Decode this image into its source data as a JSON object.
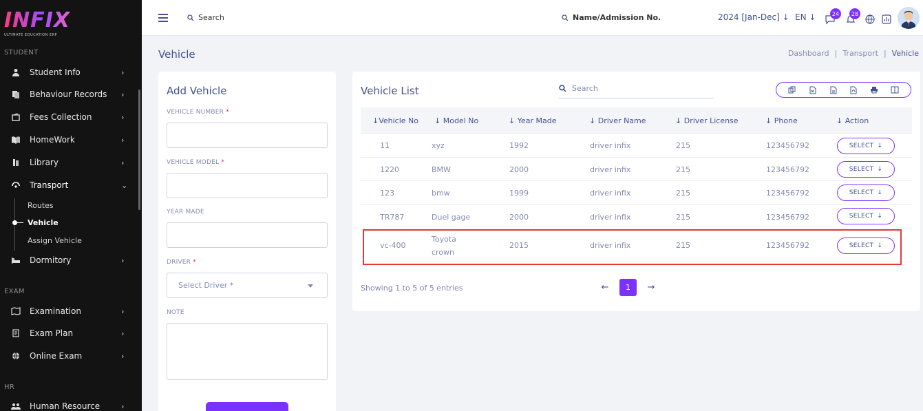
{
  "brand": {
    "logo_text": "INFIX",
    "tagline": "ULTIMATE EDUCATION ERP"
  },
  "sidebar": {
    "sections": {
      "student": "STUDENT",
      "exam": "EXAM",
      "hr": "HR"
    },
    "items": [
      {
        "label": "Student Info",
        "icon": "student-icon"
      },
      {
        "label": "Behaviour Records",
        "icon": "records-icon"
      },
      {
        "label": "Fees Collection",
        "icon": "fees-icon"
      },
      {
        "label": "HomeWork",
        "icon": "book-icon"
      },
      {
        "label": "Library",
        "icon": "library-icon"
      },
      {
        "label": "Transport",
        "icon": "transport-icon"
      },
      {
        "label": "Dormitory",
        "icon": "bed-icon"
      },
      {
        "label": "Examination",
        "icon": "map-icon"
      },
      {
        "label": "Exam Plan",
        "icon": "plan-icon"
      },
      {
        "label": "Online Exam",
        "icon": "globe-icon"
      },
      {
        "label": "Human Resource",
        "icon": "people-icon"
      }
    ],
    "transport_sub": [
      "Routes",
      "Vehicle",
      "Assign Vehicle"
    ]
  },
  "header": {
    "search_label": "Search",
    "search2_label": "Name/Admission No.",
    "year": "2024 [Jan-Dec]",
    "lang": "EN",
    "messages_count": "24",
    "notifications_count": "28"
  },
  "page": {
    "title": "Vehicle",
    "breadcrumbs": [
      "Dashboard",
      "Transport",
      "Vehicle"
    ]
  },
  "form": {
    "title": "Add Vehicle",
    "vehicle_number_label": "VEHICLE NUMBER",
    "vehicle_model_label": "VEHICLE MODEL",
    "year_made_label": "YEAR MADE",
    "driver_label": "DRIVER",
    "driver_placeholder": "Select Driver *",
    "note_label": "NOTE",
    "required_mark": "*"
  },
  "list": {
    "title": "Vehicle List",
    "search_placeholder": "Search",
    "columns": [
      "Vehicle No",
      "Model No",
      "Year Made",
      "Driver Name",
      "Driver License",
      "Phone",
      "Action"
    ],
    "rows": [
      {
        "vehicle_no": "11",
        "model_no": "xyz",
        "year": "1992",
        "driver": "driver infix",
        "license": "215",
        "phone": "123456792",
        "action": "SELECT"
      },
      {
        "vehicle_no": "1220",
        "model_no": "BMW",
        "year": "2000",
        "driver": "driver infix",
        "license": "215",
        "phone": "123456792",
        "action": "SELECT"
      },
      {
        "vehicle_no": "123",
        "model_no": "bmw",
        "year": "1999",
        "driver": "driver infix",
        "license": "215",
        "phone": "123456792",
        "action": "SELECT"
      },
      {
        "vehicle_no": "TR787",
        "model_no": "Duel gage",
        "year": "2000",
        "driver": "driver infix",
        "license": "215",
        "phone": "123456792",
        "action": "SELECT"
      },
      {
        "vehicle_no": "vc-400",
        "model_no_line1": "Toyota",
        "model_no_line2": "crown",
        "year": "2015",
        "driver": "driver infix",
        "license": "215",
        "phone": "123456792",
        "action": "SELECT"
      }
    ],
    "showing": "Showing 1 to 5 of 5 entries",
    "current_page": "1"
  },
  "colors": {
    "accent": "#7c32ff",
    "text": "#415094",
    "muted": "#828bb2",
    "highlight": "#e53935",
    "sidebar_bg": "#131313"
  }
}
